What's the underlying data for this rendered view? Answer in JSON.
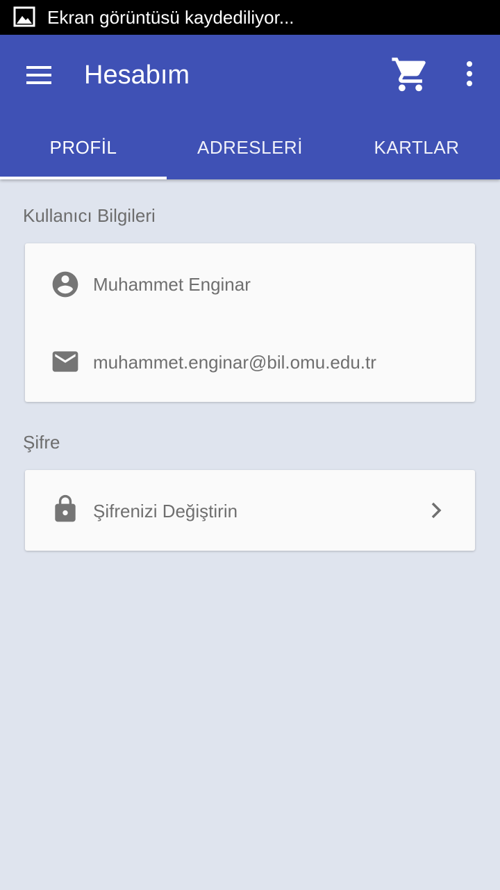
{
  "status_bar": {
    "notification_icon": "image-icon",
    "text": "Ekran görüntüsü kaydediliyor..."
  },
  "app_bar": {
    "title": "Hesabım",
    "menu_icon": "menu-icon",
    "cart_icon": "shopping-cart-icon",
    "more_icon": "more-vertical-icon",
    "color": "#3f51b5"
  },
  "tabs": [
    {
      "label": "PROFİL",
      "selected": true
    },
    {
      "label": "ADRESLERİ",
      "selected": false
    },
    {
      "label": "KARTLAR",
      "selected": false
    }
  ],
  "user_section": {
    "heading": "Kullanıcı Bilgileri",
    "name": "Muhammet Enginar",
    "name_icon": "account-circle-icon",
    "email": "muhammet.enginar@bil.omu.edu.tr",
    "email_icon": "email-icon"
  },
  "password_section": {
    "heading": "Şifre",
    "change_label": "Şifrenizi Değiştirin",
    "lock_icon": "lock-icon",
    "chevron_icon": "chevron-right-icon"
  }
}
